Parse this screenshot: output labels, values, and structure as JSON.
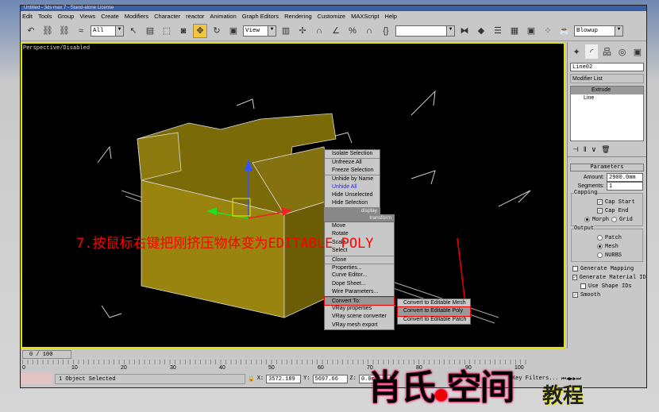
{
  "title": "Untitled - 3ds max 7 - Stand-alone License",
  "menu": [
    "Edit",
    "Tools",
    "Group",
    "Views",
    "Create",
    "Modifiers",
    "Character",
    "reactor",
    "Animation",
    "Graph Editors",
    "Rendering",
    "Customize",
    "MAXScript",
    "Help"
  ],
  "toolbar": {
    "filter": "All",
    "coord": "View",
    "render_preset": "Blowup"
  },
  "viewport": {
    "label": "Perspective/Disabled",
    "object_color": "#7a6a08"
  },
  "quad_menu": {
    "display": [
      "Isolate Selection",
      "Unfreeze All",
      "Freeze Selection",
      "Unhide by Name",
      "Unhide All",
      "Hide Unselected",
      "Hide Selection"
    ],
    "display_header": "display",
    "transform_header": "transform",
    "transform": [
      "Move",
      "Rotate",
      "Scale",
      "Select",
      "Clone",
      "Properties...",
      "Curve Editor...",
      "Dope Sheet...",
      "Wire Parameters...",
      "Convert To:",
      "VRay properties",
      "VRay scene converter",
      "VRay mesh export"
    ],
    "submenu": [
      "Convert to Editable Mesh",
      "Convert to Editable Poly",
      "Convert to Editable Patch"
    ]
  },
  "annotation": "7.按鼠标右键把刚挤压物体变为EDITABLE POLY",
  "panel": {
    "object_name": "Line02",
    "modifier_list": "Modifier List",
    "stack": [
      "Extrude",
      "Line"
    ],
    "rollout": "Parameters",
    "amount_label": "Amount:",
    "amount": "2900.0mm",
    "segments_label": "Segments:",
    "segments": "1",
    "capping": "Capping",
    "cap_start": "Cap Start",
    "cap_end": "Cap End",
    "morph": "Morph",
    "grid": "Grid",
    "output": "Output",
    "patch": "Patch",
    "mesh": "Mesh",
    "nurbs": "NURBS",
    "gen_mapping": "Generate Mapping",
    "gen_material": "Generate Material IDs",
    "use_shape": "Use Shape IDs",
    "smooth": "Smooth"
  },
  "timeline": {
    "frame": "0 / 100",
    "ticks": [
      "0",
      "10",
      "20",
      "30",
      "40",
      "50",
      "60",
      "70",
      "80",
      "90",
      "100"
    ]
  },
  "status": {
    "selected": "1 Object Selected",
    "x": "3572.189",
    "y": "5697.66",
    "z": "0.0mm",
    "key": "Key Filters..."
  },
  "watermark": {
    "main": "肖氏●空间",
    "sub": "教程"
  }
}
